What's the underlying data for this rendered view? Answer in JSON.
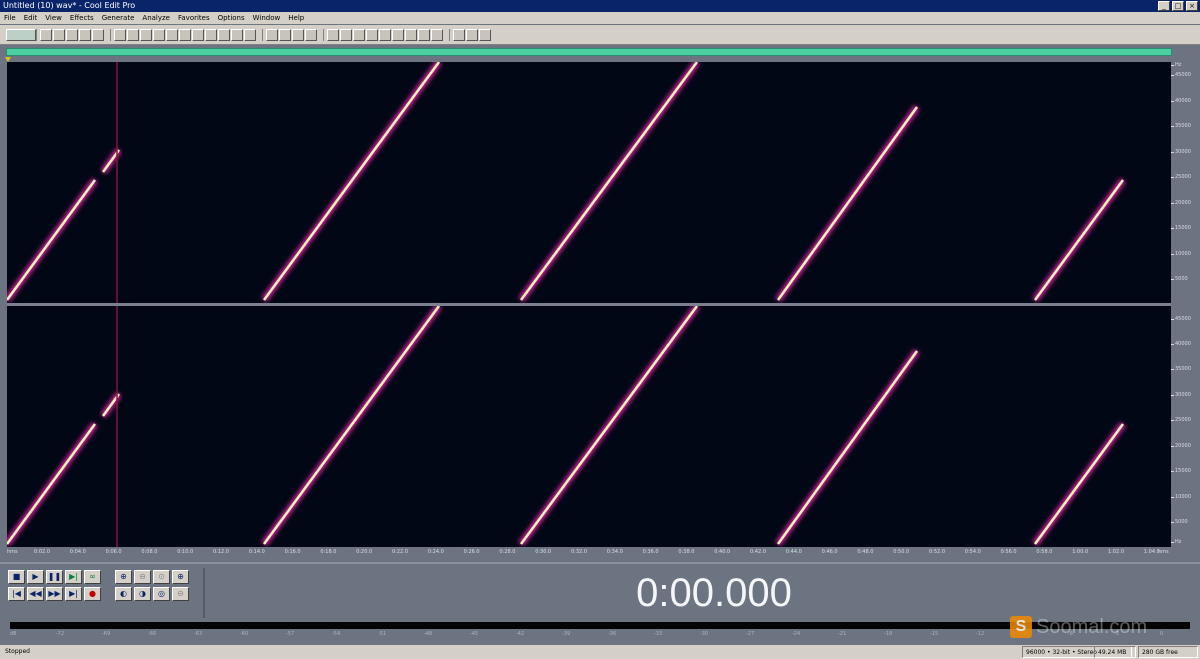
{
  "window": {
    "title": "Untitled (10) wav* - Cool Edit Pro",
    "minimize": "_",
    "maximize": "□",
    "close": "×"
  },
  "menu": [
    "File",
    "Edit",
    "View",
    "Effects",
    "Generate",
    "Analyze",
    "Favorites",
    "Options",
    "Window",
    "Help"
  ],
  "frequency_axis": {
    "unit": "Hz",
    "top_channel": [
      "45000",
      "40000",
      "35000",
      "30000",
      "25000",
      "20000",
      "15000",
      "10000",
      "5000"
    ],
    "bottom_channel": [
      "45000",
      "40000",
      "35000",
      "30000",
      "25000",
      "20000",
      "15000",
      "10000",
      "5000"
    ],
    "bottom_unit": "Hz"
  },
  "time_axis": {
    "start": "hms",
    "end": "hms",
    "ticks": [
      "0:02.0",
      "0:04.0",
      "0:06.0",
      "0:08.0",
      "0:10.0",
      "0:12.0",
      "0:14.0",
      "0:16.0",
      "0:18.0",
      "0:20.0",
      "0:22.0",
      "0:24.0",
      "0:26.0",
      "0:28.0",
      "0:30.0",
      "0:32.0",
      "0:34.0",
      "0:36.0",
      "0:38.0",
      "0:40.0",
      "0:42.0",
      "0:44.0",
      "0:46.0",
      "0:48.0",
      "0:50.0",
      "0:52.0",
      "0:54.0",
      "0:56.0",
      "0:58.0",
      "1:00.0",
      "1:02.0",
      "1:04.0"
    ]
  },
  "transport": {
    "buttons": [
      {
        "name": "stop",
        "glyph": "■"
      },
      {
        "name": "play",
        "glyph": "▶"
      },
      {
        "name": "pause",
        "glyph": "❚❚"
      },
      {
        "name": "play-to-end",
        "glyph": "▶|"
      },
      {
        "name": "loop",
        "glyph": "∞"
      },
      {
        "name": "go-to-start",
        "glyph": "|◀"
      },
      {
        "name": "rewind",
        "glyph": "◀◀"
      },
      {
        "name": "fast-forward",
        "glyph": "▶▶"
      },
      {
        "name": "go-to-end",
        "glyph": "▶|"
      },
      {
        "name": "record",
        "glyph": "●"
      }
    ]
  },
  "zoom": {
    "buttons": [
      {
        "name": "zoom-in-horizontal",
        "glyph": "⊕"
      },
      {
        "name": "zoom-out-horizontal",
        "glyph": "⊖"
      },
      {
        "name": "zoom-full",
        "glyph": "⊙"
      },
      {
        "name": "zoom-in-vertical",
        "glyph": "⊕"
      },
      {
        "name": "zoom-left",
        "glyph": "◐"
      },
      {
        "name": "zoom-right",
        "glyph": "◑"
      },
      {
        "name": "zoom-selection",
        "glyph": "◎"
      },
      {
        "name": "zoom-out-vertical",
        "glyph": "⊖"
      }
    ]
  },
  "time_display": "0:00.000",
  "level_meter": {
    "ticks": [
      "dB",
      "-72",
      "-69",
      "-66",
      "-63",
      "-60",
      "-57",
      "-54",
      "-51",
      "-48",
      "-45",
      "-42",
      "-39",
      "-36",
      "-33",
      "-30",
      "-27",
      "-24",
      "-21",
      "-18",
      "-15",
      "-12",
      "-9",
      "-6",
      "-3",
      "0"
    ]
  },
  "watermark": {
    "logo": "S",
    "text": "Soomal.com"
  },
  "status": {
    "state": "Stopped",
    "format": "96000 • 32-bit • Stereo",
    "size": "49.24 MB",
    "free": "280 GB free"
  },
  "colors": {
    "spectrogram_bg": "#020716",
    "sweep_core": "#fff1c0",
    "sweep_glow": "#c0208a",
    "overview": "#4ccfa0",
    "titlebar": "#0a246a"
  }
}
